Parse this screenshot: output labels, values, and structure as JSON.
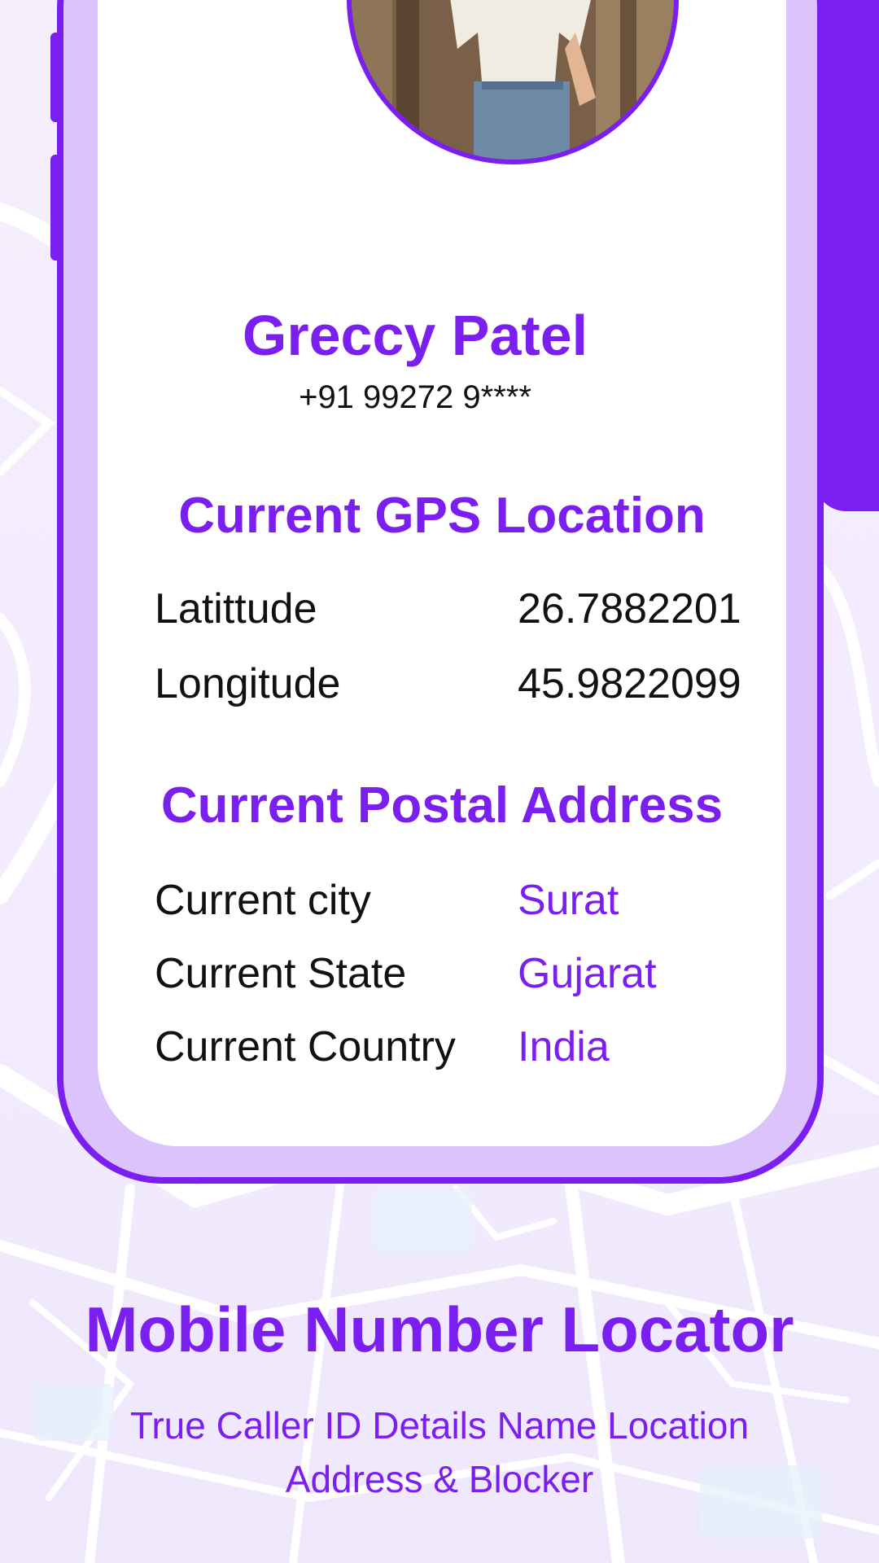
{
  "profile": {
    "name": "Greccy Patel",
    "phone": "+91 99272 9****"
  },
  "gps": {
    "title": "Current GPS Location",
    "rows": [
      {
        "label": "Latittude",
        "value": "26.7882201"
      },
      {
        "label": "Longitude",
        "value": "45.9822099"
      }
    ]
  },
  "postal": {
    "title": "Current Postal Address",
    "rows": [
      {
        "label": "Current city",
        "value": "Surat"
      },
      {
        "label": "Current State",
        "value": "Gujarat"
      },
      {
        "label": "Current Country",
        "value": "India"
      }
    ]
  },
  "promo": {
    "title": "Mobile Number Locator",
    "subtitle_line1": "True Caller ID Details Name Location",
    "subtitle_line2": "Address & Blocker"
  },
  "colors": {
    "accent": "#7b1ff0",
    "frame": "#dcc3fb",
    "background": "#f3ecff",
    "text": "#111111"
  },
  "icons": {
    "avatar": "profile-photo"
  }
}
